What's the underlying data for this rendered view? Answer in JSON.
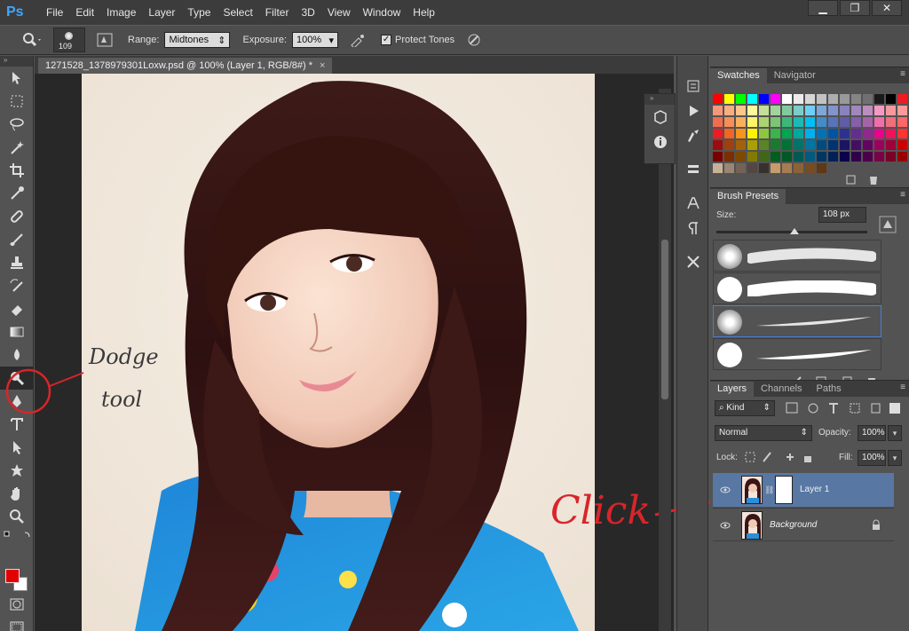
{
  "app": {
    "logo_text": "Ps"
  },
  "menu": [
    "File",
    "Edit",
    "Image",
    "Layer",
    "Type",
    "Select",
    "Filter",
    "3D",
    "View",
    "Window",
    "Help"
  ],
  "window_controls": {
    "minimize": "▁",
    "restore": "❐",
    "close": "✕"
  },
  "options_bar": {
    "brush_size": "109",
    "range_label": "Range:",
    "range_value": "Midtones",
    "exposure_label": "Exposure:",
    "exposure_value": "100%",
    "protect_tones_label": "Protect Tones",
    "protect_tones_checked": "✓"
  },
  "document": {
    "tab_title": "1271528_1378979301Loxw.psd @ 100% (Layer 1, RGB/8#) *",
    "close_glyph": "×"
  },
  "annotations": {
    "dodge_line1": "Dodge",
    "dodge_line2": "tool",
    "click": "Click"
  },
  "swatches_panel": {
    "tabs": [
      "Swatches",
      "Navigator"
    ],
    "colors": [
      "#ff0000",
      "#ffff00",
      "#00ff00",
      "#00ffff",
      "#0000ff",
      "#ff00ff",
      "#ffffff",
      "#ebebeb",
      "#d6d6d6",
      "#c2c2c2",
      "#adadad",
      "#999999",
      "#858585",
      "#707070",
      "#1a1a1a",
      "#000000",
      "#ed1c24",
      "#f7977a",
      "#f9ad81",
      "#fdc68a",
      "#fff79a",
      "#c4df9b",
      "#a2d39c",
      "#82ca9d",
      "#7bcdc8",
      "#6ecff6",
      "#7ea7d8",
      "#8493ca",
      "#8882be",
      "#a187be",
      "#bc8dbf",
      "#f49ac2",
      "#f6989d",
      "#ff9999",
      "#f26c4f",
      "#f68e55",
      "#fbaf5c",
      "#fff467",
      "#acd372",
      "#7cc576",
      "#3bb878",
      "#1abbb4",
      "#00bff3",
      "#438ccb",
      "#5574b9",
      "#605ca8",
      "#855fa8",
      "#a763a8",
      "#f06ea9",
      "#f26d7d",
      "#ff6666",
      "#ed1c24",
      "#f26522",
      "#f7941d",
      "#fff200",
      "#8dc63f",
      "#39b54a",
      "#00a651",
      "#00a99d",
      "#00aeef",
      "#0072bc",
      "#0054a6",
      "#2e3192",
      "#662d91",
      "#92278f",
      "#ec008c",
      "#ed145b",
      "#ff3333",
      "#9e0b0f",
      "#a0410d",
      "#a36209",
      "#aba000",
      "#598527",
      "#1a7b30",
      "#007236",
      "#00746b",
      "#0076a3",
      "#004b80",
      "#003471",
      "#1b1464",
      "#440e62",
      "#630460",
      "#9e005d",
      "#9e0039",
      "#cc0000",
      "#790000",
      "#7b2e00",
      "#7d4900",
      "#827b00",
      "#406618",
      "#005e20",
      "#005826",
      "#005952",
      "#005b7f",
      "#003663",
      "#002157",
      "#0d004c",
      "#32004b",
      "#4b0049",
      "#7b0046",
      "#7a0026",
      "#990000",
      "#c7b299",
      "#998675",
      "#736357",
      "#534741",
      "#37302d",
      "#c69c6d",
      "#a67c52",
      "#8c6239",
      "#754c24",
      "#603913"
    ]
  },
  "brush_presets": {
    "tab": "Brush Presets",
    "size_label": "Size:",
    "size_value": "108 px",
    "slider_fraction": 0.52
  },
  "layers_panel": {
    "tabs": [
      "Layers",
      "Channels",
      "Paths"
    ],
    "kind_label": "Kind",
    "blend_mode": "Normal",
    "opacity_label": "Opacity:",
    "opacity_value": "100%",
    "lock_label": "Lock:",
    "fill_label": "Fill:",
    "fill_value": "100%",
    "layers": [
      {
        "name": "Layer 1",
        "selected": true
      },
      {
        "name": "Background",
        "selected": false
      }
    ]
  },
  "colors": {
    "foreground": "#e30000",
    "background": "#ffffff",
    "accent": "#5877a3"
  }
}
